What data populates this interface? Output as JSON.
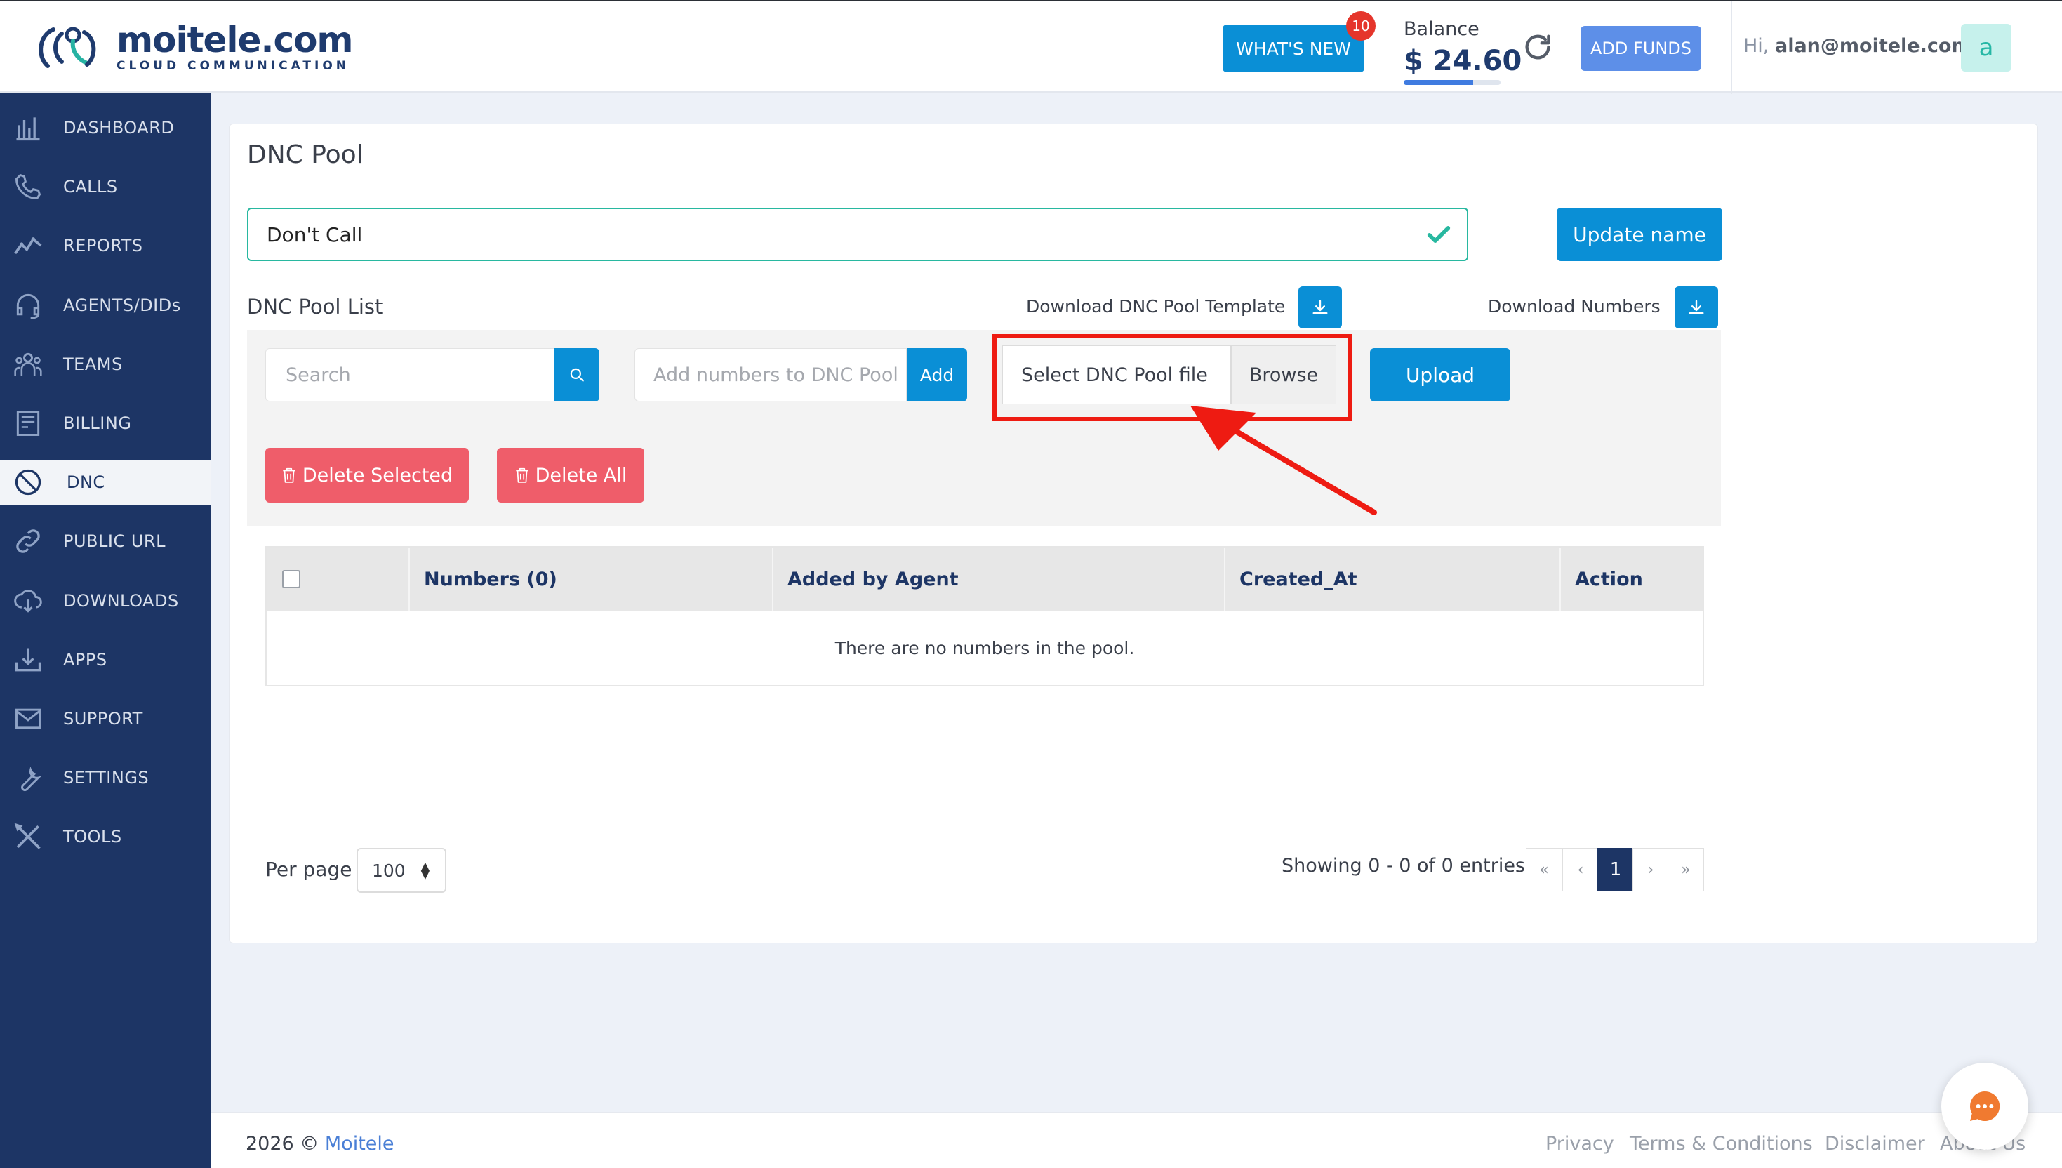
{
  "header": {
    "logo_name": "moitele.com",
    "logo_tagline": "CLOUD COMMUNICATION",
    "whats_new_label": "WHAT'S NEW",
    "whats_new_badge": "10",
    "balance_label": "Balance",
    "balance_value": "$ 24.60",
    "balance_progress": 0.72,
    "add_funds_label": "ADD FUNDS",
    "greeting_prefix": "Hi,",
    "user_email": "alan@moitele.com",
    "avatar_letter": "a"
  },
  "sidebar": {
    "items": [
      {
        "label": "DASHBOARD",
        "icon": "dashboard-icon"
      },
      {
        "label": "CALLS",
        "icon": "phone-icon"
      },
      {
        "label": "REPORTS",
        "icon": "chart-icon"
      },
      {
        "label": "AGENTS/DIDs",
        "icon": "headset-icon"
      },
      {
        "label": "TEAMS",
        "icon": "teams-icon"
      },
      {
        "label": "BILLING",
        "icon": "invoice-icon"
      },
      {
        "label": "DNC",
        "icon": "block-icon",
        "active": true
      },
      {
        "label": "PUBLIC URL",
        "icon": "link-icon"
      },
      {
        "label": "DOWNLOADS",
        "icon": "cloud-download-icon"
      },
      {
        "label": "APPS",
        "icon": "download-box-icon"
      },
      {
        "label": "SUPPORT",
        "icon": "mail-icon"
      },
      {
        "label": "SETTINGS",
        "icon": "wrench-icon"
      },
      {
        "label": "TOOLS",
        "icon": "tools-icon"
      }
    ]
  },
  "main": {
    "title": "DNC Pool",
    "pool_name_value": "Don't Call",
    "update_name_label": "Update name",
    "list_title": "DNC Pool List",
    "download_template_label": "Download DNC Pool Template",
    "download_numbers_label": "Download Numbers",
    "search_placeholder": "Search",
    "add_placeholder": "Add numbers to DNC Pool",
    "add_label": "Add",
    "file_placeholder": "Select DNC Pool file",
    "browse_label": "Browse",
    "upload_label": "Upload",
    "delete_selected_label": "Delete Selected",
    "delete_all_label": "Delete All",
    "table": {
      "columns": [
        "Numbers (0)",
        "Added by Agent",
        "Created_At",
        "Action"
      ],
      "empty_message": "There are no numbers in the pool."
    },
    "per_page_label": "Per page",
    "per_page_value": "100",
    "showing_text": "Showing 0 - 0 of 0 entries",
    "pagination": [
      "«",
      "‹",
      "1",
      "›",
      "»"
    ],
    "current_page": "1"
  },
  "footer": {
    "year": "2026 ©",
    "brand": "Moitele",
    "links": [
      "Privacy",
      "Terms & Conditions",
      "Disclaimer",
      "About Us"
    ]
  },
  "colors": {
    "primary": "#0a8fd6",
    "sidebar": "#1d3565",
    "danger": "#ef5d6a",
    "highlight": "#ee1b12",
    "success": "#28b8a0"
  }
}
